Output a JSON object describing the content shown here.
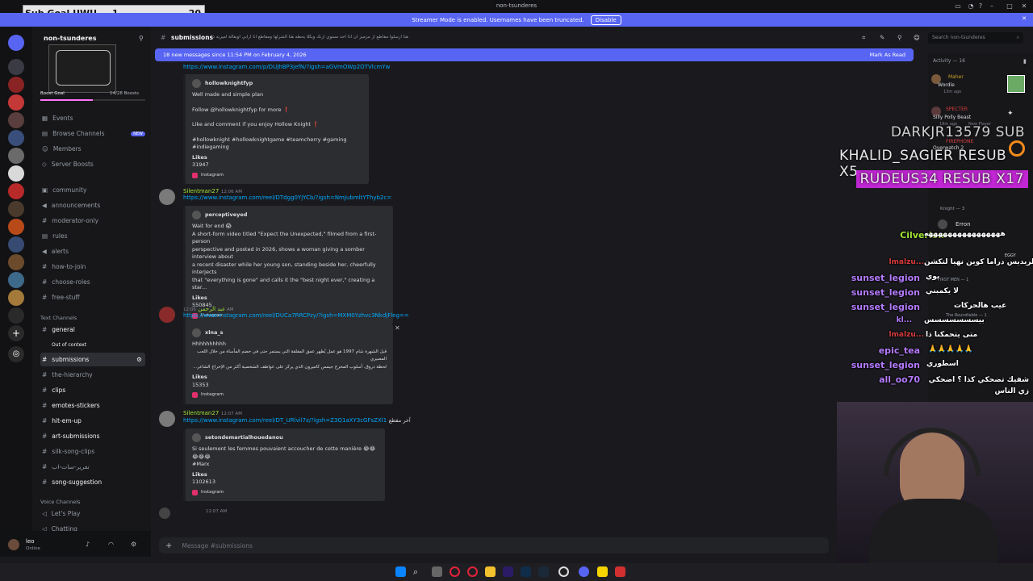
{
  "window": {
    "title": "non-tsunderes"
  },
  "banner": {
    "text": "Streamer Mode is enabled. Usernames have been truncated.",
    "disable_label": "Disable"
  },
  "sub_goal": {
    "label": "Sub Goal UWU",
    "current": "1",
    "target": "20"
  },
  "server": {
    "name": "non-tsunderes",
    "boost_goal": "Boost Goal",
    "boost_count": "14/28 Boosts"
  },
  "channel_nav": [
    {
      "label": "Events"
    },
    {
      "label": "Browse Channels",
      "badge": "NEW"
    },
    {
      "label": "Members"
    },
    {
      "label": "Server Boosts"
    }
  ],
  "channels_top": [
    "community",
    "announcements",
    "moderator-only",
    "rules",
    "alerts",
    "how-to-join",
    "choose-roles",
    "free-stuff"
  ],
  "text_category": "Text Channels",
  "text_channels": [
    "general",
    "Out of context",
    "submissions",
    "the-hierarchy",
    "clips",
    "emotes-stickers",
    "hit-em-up",
    "art-submissions",
    "silk-song-clips",
    "تفرير-سات-اب",
    "song-suggestion"
  ],
  "voice_category": "Voice Channels",
  "voice_channels": [
    "Let's Play",
    "Chatting"
  ],
  "user": {
    "name": "leo",
    "status": "Online"
  },
  "header": {
    "channel": "submissions",
    "topic": "هنا ارسلوا مقاطع از مزميز ان اذا احد مسوي ارنك ويكلا يحطه هنا الشرلها ومقاطع انا ارابي اويقالة اميزيه ذا",
    "search_placeholder": "Search non-tsunderes"
  },
  "new_messages": {
    "text": "18 new messages since 11:54 PM on February 4, 2026",
    "mark_read": "Mark As Read"
  },
  "messages": [
    {
      "link": "https://www.instagram.com/p/DUJhBP3jefN/?igsh=aGVmOWp2OTVlcmYw",
      "embed_author": "hollowknightfyp",
      "lines": [
        "Well made and simple plan",
        "",
        "Follow @hollowknightfyp for more ❗",
        "",
        "Like and comment if you enjoy Hollow Knight ❗",
        "",
        "#hollowknight #hollowknightgame #teamcherry #gaming #indiegaming"
      ],
      "likes_label": "Likes",
      "likes": "31947",
      "footer": "Instagram"
    },
    {
      "name": "Silentman27",
      "time": "12:06 AM",
      "link": "https://www.instagram.com/reel/DTdgg0YjYCb/?igsh=NmJubmltYThyb2c=",
      "embed_author": "perceptiveyed",
      "lines": [
        "Wait for end 😱",
        "A short-form video titled \"Expect the Unexpected,\" filmed from a first-person",
        "perspective and posted in 2026, shows a woman giving a somber interview about",
        "a recent disaster while her young son, standing beside her, cheerfully interjects",
        "that \"everything is gone\" and calls it the \"best night ever,\" creating a star..."
      ],
      "likes_label": "Likes",
      "likes": "550845",
      "footer": "Instagram"
    },
    {
      "name": "عبد الرحمن",
      "time": "12:06 AM",
      "link": "https://www.instagram.com/reel/DUCa7RRCPzy/?igsh=MXM0Yzhvc3NkdjFleg==",
      "embed_author": "xlna_s",
      "lines": [
        "Hhhhhhhhhh",
        "قبل الشهرة شام 1997 هو عمل يُظهر عمق المقلقة التي يستمر حتى في خضم المأساة من خلال اللعب المصيري",
        "لحظة دروق. أسلوب المخرج جيمس كاميرون الذي يركز على عواطف الشخصية أكثر من الإخراج الشاعر..."
      ],
      "likes_label": "Likes",
      "likes": "15353",
      "footer": "Instagram"
    },
    {
      "name": "Silentman27",
      "time": "12:07 AM",
      "link": "https://www.instagram.com/reel/DT_URlvil7z/?igsh=Z3Q1aXY3cGFsZXl1",
      "link_suffix": "آخر مقطع",
      "embed_author": "setondemartialhouedanou",
      "lines": [
        "Si seulement les femmes pouvaient accoucher de cette manière 😂😂😂😂😂",
        "#Marx"
      ],
      "likes_label": "Likes",
      "likes": "1102613",
      "footer": "Instagram"
    }
  ],
  "last_msg_time": "12:07 AM",
  "composer": {
    "placeholder": "Message #submissions"
  },
  "members": {
    "activity": "Activity — 16",
    "items": [
      {
        "name": "Maher",
        "activity": "Wordle",
        "time": "13m ago"
      },
      {
        "name": "SPECTER",
        "activity": "Silly Polly Beast",
        "time": "19m ago",
        "tag": "New Player"
      },
      {
        "name": "FIREPHONE",
        "activity": "Overwatch 2"
      }
    ],
    "knight": "Knight — 3",
    "erron": "Erron",
    "first_men": "FIRST MEN — 1",
    "roundtable": "The Roundtable — 1",
    "eggy": "EGGY"
  },
  "overlay_alerts": [
    {
      "name": "DARKJR13579",
      "action": "SUB"
    },
    {
      "name": "KHALID_SAGIER",
      "action": "RESUB X5"
    },
    {
      "name": "RUDEUS34",
      "action": "RESUB X17"
    }
  ],
  "overlay_chat": [
    {
      "user": "Cilverion",
      "text": "ههههههههههههههههه"
    },
    {
      "user": "lmalzu...",
      "text": "الريديس دراما كوين نهيا لتكشن"
    },
    {
      "user": "sunset_legion",
      "text": "بوي"
    },
    {
      "user": "sunset_legion",
      "text": "لا يكمبني"
    },
    {
      "user": "sunset_legion",
      "text": "عيب هالحركات"
    },
    {
      "user": "kl...",
      "text": "بيسسسسسسس"
    },
    {
      "user": "lmalzu...",
      "text": "متى يتحمكنا ذا"
    },
    {
      "user": "epic_tea",
      "text": "🙏🙏🙏🙏🙏"
    },
    {
      "user": "sunset_legion",
      "text": "اسطوري"
    },
    {
      "user": "all_oo70",
      "text": "شفيك تضحكي كذا ؟ اضحكي زي الناس"
    }
  ],
  "colors": {
    "accent": "#5865f2",
    "green_name": "#a3e635",
    "link": "#00a8fc",
    "overlay_user": "#b57bff",
    "alert_pink": "#c026d3"
  }
}
